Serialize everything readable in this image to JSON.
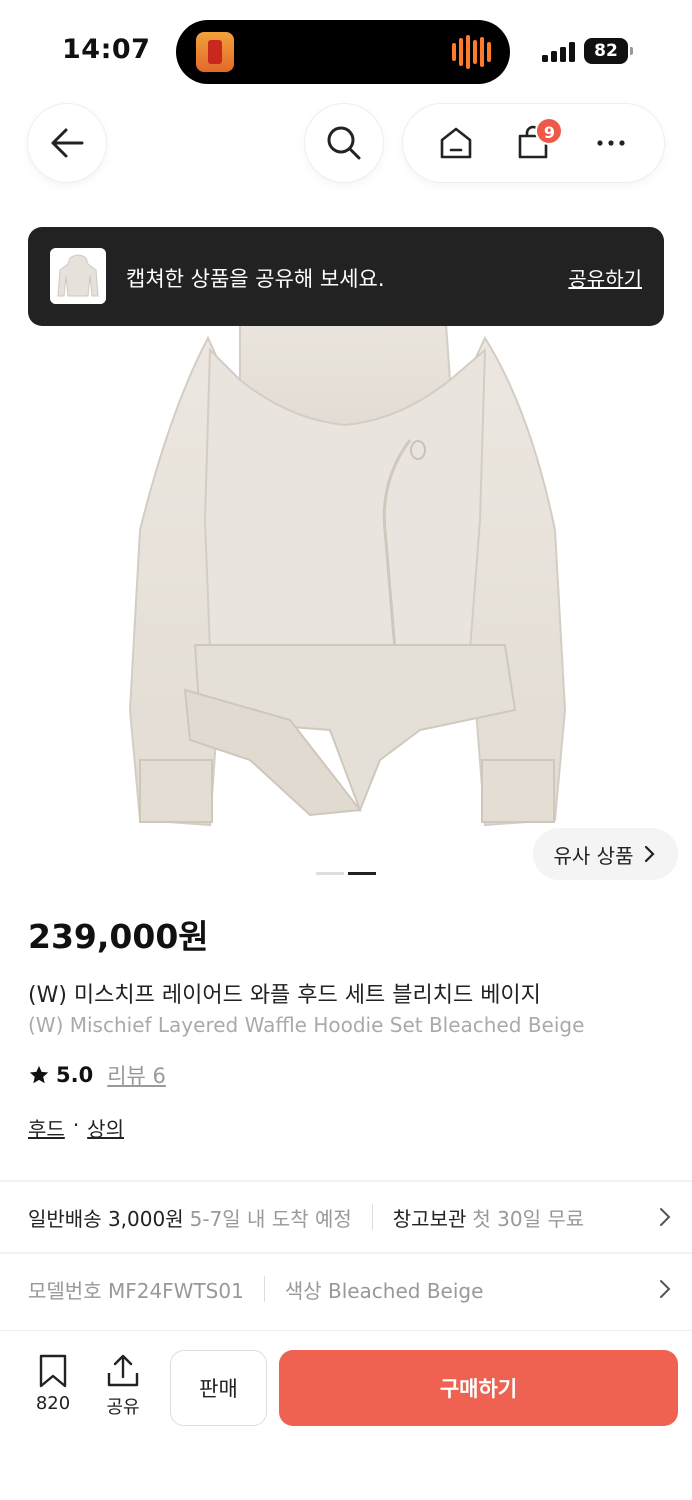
{
  "status_bar": {
    "time": "14:07",
    "battery": "82",
    "icons": [
      "app-icon",
      "waveform-icon",
      "signal-icon",
      "battery-icon"
    ]
  },
  "nav": {
    "cart_badge": "9",
    "icons": [
      "back-arrow-icon",
      "search-icon",
      "home-icon",
      "shopping-bag-icon",
      "more-icon"
    ]
  },
  "toast": {
    "message": "캡쳐한 상품을 공유해 보세요.",
    "action": "공유하기"
  },
  "product": {
    "similar_label": "유사 상품",
    "price": "239,000원",
    "name_ko": "(W) 미스치프 레이어드 와플 후드 세트 블리치드 베이지",
    "name_en": "(W) Mischief Layered Waffle Hoodie Set Bleached Beige",
    "rating": "5.0",
    "review_label": "리뷰 6",
    "categories": [
      "후드",
      "상의"
    ],
    "category_sep": "·"
  },
  "shipping": {
    "label": "일반배송 3,000원",
    "eta": "5-7일 내 도착 예정",
    "storage_label": "창고보관",
    "storage_note": "첫 30일 무료"
  },
  "meta": {
    "model": "모델번호 MF24FWTS01",
    "color": "색상 Bleached Beige"
  },
  "bottom_bar": {
    "wish_count": "820",
    "share_label": "공유",
    "sell_label": "판매",
    "buy_label": "구매하기"
  },
  "colors": {
    "accent": "#ef6151",
    "badge": "#ee5a4a",
    "toast_bg": "#222222",
    "muted_text": "#999999"
  }
}
